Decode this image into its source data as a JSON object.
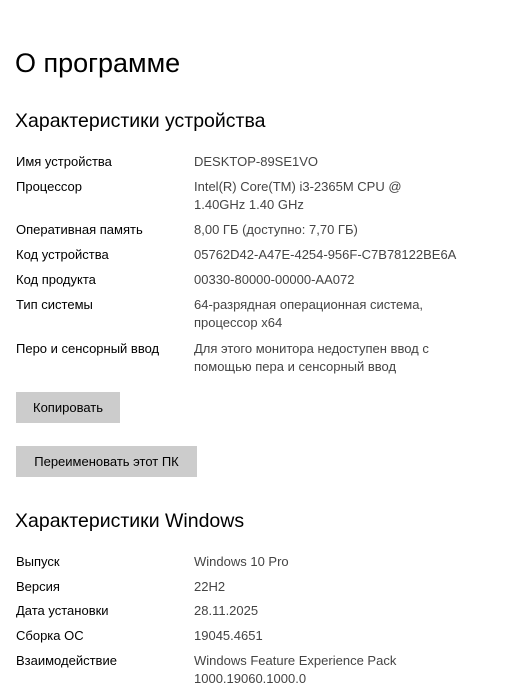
{
  "page": {
    "title": "О программе"
  },
  "device": {
    "section_title": "Характеристики устройства",
    "rows": [
      {
        "label": "Имя устройства",
        "value": "DESKTOP-89SE1VO"
      },
      {
        "label": "Процессор",
        "value": "Intel(R) Core(TM) i3-2365M CPU @ 1.40GHz   1.40 GHz"
      },
      {
        "label": "Оперативная память",
        "value": "8,00 ГБ (доступно: 7,70 ГБ)"
      },
      {
        "label": "Код устройства",
        "value": "05762D42-A47E-4254-956F-C7B78122BE6A"
      },
      {
        "label": "Код продукта",
        "value": "00330-80000-00000-AA072"
      },
      {
        "label": "Тип системы",
        "value": "64-разрядная операционная система, процессор x64"
      },
      {
        "label": "Перо и сенсорный ввод",
        "value": "Для этого монитора недоступен ввод с помощью пера и сенсорный ввод"
      }
    ],
    "copy_button": "Копировать",
    "rename_button": "Переименовать этот ПК"
  },
  "windows": {
    "section_title": "Характеристики Windows",
    "rows": [
      {
        "label": "Выпуск",
        "value": "Windows 10 Pro"
      },
      {
        "label": "Версия",
        "value": "22H2"
      },
      {
        "label": "Дата установки",
        "value": "28.11.2025"
      },
      {
        "label": "Сборка ОС",
        "value": "19045.4651"
      },
      {
        "label": "Взаимодействие",
        "value": "Windows Feature Experience Pack 1000.19060.1000.0"
      }
    ]
  }
}
